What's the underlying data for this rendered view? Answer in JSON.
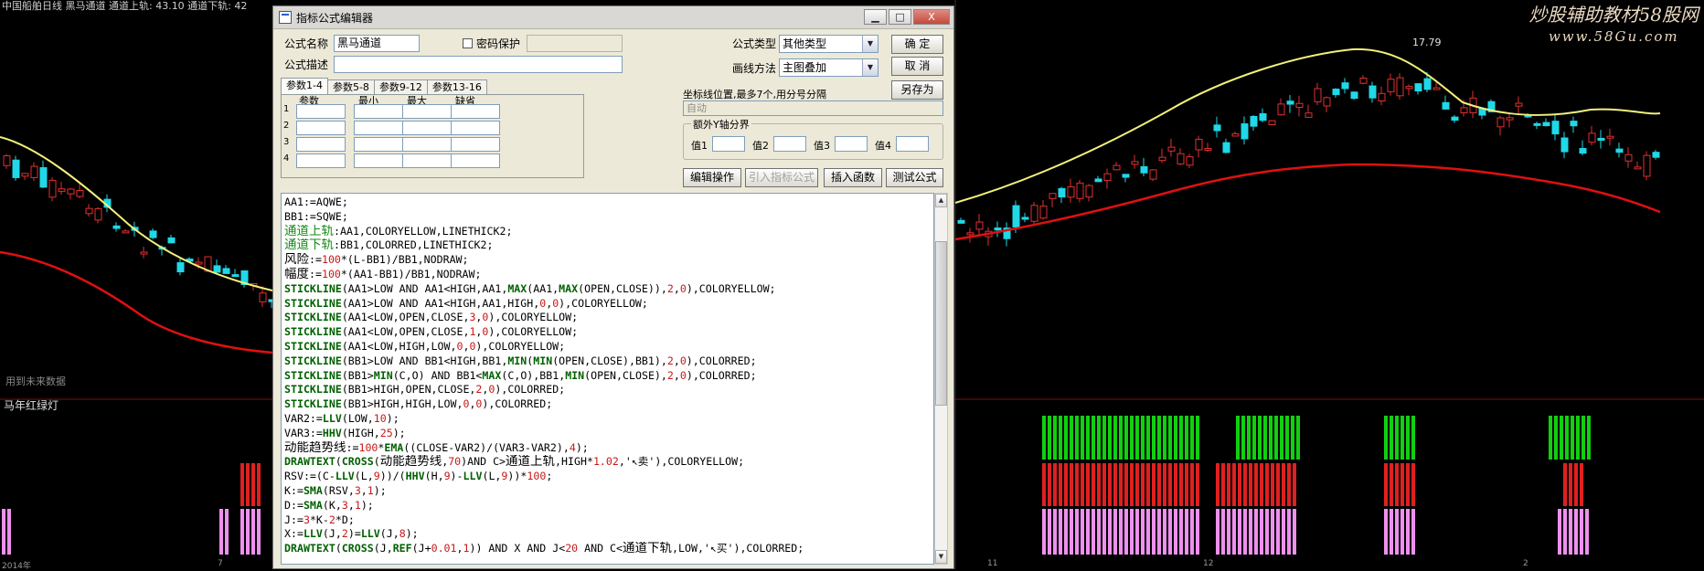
{
  "chart": {
    "top_info": "中国船舶日线  黑马通道  通道上轨: 43.10  通道下轨: 42",
    "peak_label": "17.79",
    "mid_label": "用到未来数据",
    "sub_indicator_label": "马年红绿灯",
    "dates": [
      "2014年",
      "7",
      "11",
      "12",
      "2"
    ],
    "colors": {
      "upper_band": "#f2f07a",
      "lower_band": "#e01010",
      "up_candle": "#e03030",
      "down_candle": "#20d8e8",
      "green_bar": "#10d010",
      "red_bar": "#e02020",
      "pink_bar": "#ee90ee"
    }
  },
  "watermark": {
    "line1": "炒股辅助教材58股网",
    "line2": "www.58Gu.com"
  },
  "dialog": {
    "title": "指标公式编辑器",
    "win_min": "▁",
    "win_max": "□",
    "win_close": "X",
    "name_label": "公式名称",
    "name_value": "黑马通道",
    "password_label": "密码保护",
    "password_value": "",
    "desc_label": "公式描述",
    "desc_value": "",
    "type_label": "公式类型",
    "type_value": "其他类型",
    "draw_label": "画线方法",
    "draw_value": "主图叠加",
    "ok_button": "确  定",
    "cancel_button": "取  消",
    "saveas_button": "另存为",
    "tabs": [
      "参数1-4",
      "参数5-8",
      "参数9-12",
      "参数13-16"
    ],
    "param_headers": [
      "参数",
      "最小",
      "最大",
      "缺省"
    ],
    "param_rows": [
      "1",
      "2",
      "3",
      "4"
    ],
    "coord_label": "坐标线位置,最多7个,用分号分隔",
    "coord_value": "自动",
    "extra_y_legend": "额外Y轴分界",
    "y_labels": [
      "值1",
      "值2",
      "值3",
      "值4"
    ],
    "edit_button": "编辑操作",
    "import_button": "引入指标公式",
    "insert_func_button": "插入函数",
    "test_button": "测试公式",
    "code": [
      [
        [
          "AA1:=AQWE;",
          "black"
        ]
      ],
      [
        [
          "BB1:=SQWE;",
          "black"
        ]
      ],
      [
        [
          "通道上轨",
          "green big"
        ],
        [
          ":AA1,COLORYELLOW,LINETHICK2;",
          "black"
        ]
      ],
      [
        [
          "通道下轨",
          "green big"
        ],
        [
          ":BB1,COLORRED,LINETHICK2;",
          "black"
        ]
      ],
      [
        [
          "风险",
          "black big"
        ],
        [
          ":=",
          "black"
        ],
        [
          "100",
          "red"
        ],
        [
          "*(L-BB1)/BB1,NODRAW;",
          "black"
        ]
      ],
      [
        [
          "幅度",
          "black big"
        ],
        [
          ":=",
          "black"
        ],
        [
          "100",
          "red"
        ],
        [
          "*(AA1-BB1)/BB1,NODRAW;",
          "black"
        ]
      ],
      [
        [
          "STICKLINE",
          "darkgreen bold"
        ],
        [
          "(AA1>LOW AND AA1<HIGH,AA1,",
          "black"
        ],
        [
          "MAX",
          "darkgreen bold"
        ],
        [
          "(AA1,",
          "black"
        ],
        [
          "MAX",
          "darkgreen bold"
        ],
        [
          "(OPEN,CLOSE)),",
          "black"
        ],
        [
          "2",
          "red"
        ],
        [
          ",",
          "black"
        ],
        [
          "0",
          "red"
        ],
        [
          "),COLORYELLOW;",
          "black"
        ]
      ],
      [
        [
          "STICKLINE",
          "darkgreen bold"
        ],
        [
          "(AA1>LOW AND AA1<HIGH,AA1,HIGH,",
          "black"
        ],
        [
          "0",
          "red"
        ],
        [
          ",",
          "black"
        ],
        [
          "0",
          "red"
        ],
        [
          "),COLORYELLOW;",
          "black"
        ]
      ],
      [
        [
          "STICKLINE",
          "darkgreen bold"
        ],
        [
          "(AA1<LOW,OPEN,CLOSE,",
          "black"
        ],
        [
          "3",
          "red"
        ],
        [
          ",",
          "black"
        ],
        [
          "0",
          "red"
        ],
        [
          "),COLORYELLOW;",
          "black"
        ]
      ],
      [
        [
          "STICKLINE",
          "darkgreen bold"
        ],
        [
          "(AA1<LOW,OPEN,CLOSE,",
          "black"
        ],
        [
          "1",
          "red"
        ],
        [
          ",",
          "black"
        ],
        [
          "0",
          "red"
        ],
        [
          "),COLORYELLOW;",
          "black"
        ]
      ],
      [
        [
          "STICKLINE",
          "darkgreen bold"
        ],
        [
          "(AA1<LOW,HIGH,LOW,",
          "black"
        ],
        [
          "0",
          "red"
        ],
        [
          ",",
          "black"
        ],
        [
          "0",
          "red"
        ],
        [
          "),COLORYELLOW;",
          "black"
        ]
      ],
      [
        [
          "STICKLINE",
          "darkgreen bold"
        ],
        [
          "(BB1>LOW AND BB1<HIGH,BB1,",
          "black"
        ],
        [
          "MIN",
          "darkgreen bold"
        ],
        [
          "(",
          "black"
        ],
        [
          "MIN",
          "darkgreen bold"
        ],
        [
          "(OPEN,CLOSE),BB1),",
          "black"
        ],
        [
          "2",
          "red"
        ],
        [
          ",",
          "black"
        ],
        [
          "0",
          "red"
        ],
        [
          "),COLORRED;",
          "black"
        ]
      ],
      [
        [
          "STICKLINE",
          "darkgreen bold"
        ],
        [
          "(BB1>",
          "black"
        ],
        [
          "MIN",
          "darkgreen bold"
        ],
        [
          "(C,O) AND BB1<",
          "black"
        ],
        [
          "MAX",
          "darkgreen bold"
        ],
        [
          "(C,O),BB1,",
          "black"
        ],
        [
          "MIN",
          "darkgreen bold"
        ],
        [
          "(OPEN,CLOSE),",
          "black"
        ],
        [
          "2",
          "red"
        ],
        [
          ",",
          "black"
        ],
        [
          "0",
          "red"
        ],
        [
          "),COLORRED;",
          "black"
        ]
      ],
      [
        [
          "STICKLINE",
          "darkgreen bold"
        ],
        [
          "(BB1>HIGH,OPEN,CLOSE,",
          "black"
        ],
        [
          "2",
          "red"
        ],
        [
          ",",
          "black"
        ],
        [
          "0",
          "red"
        ],
        [
          "),COLORRED;",
          "black"
        ]
      ],
      [
        [
          "STICKLINE",
          "darkgreen bold"
        ],
        [
          "(BB1>HIGH,HIGH,LOW,",
          "black"
        ],
        [
          "0",
          "red"
        ],
        [
          ",",
          "black"
        ],
        [
          "0",
          "red"
        ],
        [
          "),COLORRED;",
          "black"
        ]
      ],
      [
        [
          "VAR2:=",
          "black"
        ],
        [
          "LLV",
          "darkgreen bold"
        ],
        [
          "(LOW,",
          "black"
        ],
        [
          "10",
          "red"
        ],
        [
          ");",
          "black"
        ]
      ],
      [
        [
          "VAR3:=",
          "black"
        ],
        [
          "HHV",
          "darkgreen bold"
        ],
        [
          "(HIGH,",
          "black"
        ],
        [
          "25",
          "red"
        ],
        [
          ");",
          "black"
        ]
      ],
      [
        [
          "动能趋势线",
          "black big"
        ],
        [
          ":=",
          "black"
        ],
        [
          "100",
          "red"
        ],
        [
          "*",
          "black"
        ],
        [
          "EMA",
          "darkgreen bold"
        ],
        [
          "((CLOSE-VAR2)/(VAR3-VAR2),",
          "black"
        ],
        [
          "4",
          "red"
        ],
        [
          ");",
          "black"
        ]
      ],
      [
        [
          "DRAWTEXT",
          "darkgreen bold"
        ],
        [
          "(",
          "black"
        ],
        [
          "CROSS",
          "darkgreen bold"
        ],
        [
          "(",
          "black"
        ],
        [
          "动能趋势线",
          "black big"
        ],
        [
          ",",
          "black"
        ],
        [
          "70",
          "red"
        ],
        [
          ")AND C>",
          "black"
        ],
        [
          "通道上轨",
          "black big"
        ],
        [
          ",HIGH*",
          "black"
        ],
        [
          "1.02",
          "red"
        ],
        [
          ",'↖卖'),COLORYELLOW;",
          "black"
        ]
      ],
      [
        [
          "RSV:=(C-",
          "black"
        ],
        [
          "LLV",
          "darkgreen bold"
        ],
        [
          "(L,",
          "black"
        ],
        [
          "9",
          "red"
        ],
        [
          "))/(",
          "black"
        ],
        [
          "HHV",
          "darkgreen bold"
        ],
        [
          "(H,",
          "black"
        ],
        [
          "9",
          "red"
        ],
        [
          ")-",
          "black"
        ],
        [
          "LLV",
          "darkgreen bold"
        ],
        [
          "(L,",
          "black"
        ],
        [
          "9",
          "red"
        ],
        [
          "))*",
          "black"
        ],
        [
          "100",
          "red"
        ],
        [
          ";",
          "black"
        ]
      ],
      [
        [
          "K:=",
          "black"
        ],
        [
          "SMA",
          "darkgreen bold"
        ],
        [
          "(RSV,",
          "black"
        ],
        [
          "3",
          "red"
        ],
        [
          ",",
          "black"
        ],
        [
          "1",
          "red"
        ],
        [
          ");",
          "black"
        ]
      ],
      [
        [
          "D:=",
          "black"
        ],
        [
          "SMA",
          "darkgreen bold"
        ],
        [
          "(K,",
          "black"
        ],
        [
          "3",
          "red"
        ],
        [
          ",",
          "black"
        ],
        [
          "1",
          "red"
        ],
        [
          ");",
          "black"
        ]
      ],
      [
        [
          "J:=",
          "black"
        ],
        [
          "3",
          "red"
        ],
        [
          "*K-",
          "black"
        ],
        [
          "2",
          "red"
        ],
        [
          "*D;",
          "black"
        ]
      ],
      [
        [
          "X:=",
          "black"
        ],
        [
          "LLV",
          "darkgreen bold"
        ],
        [
          "(J,",
          "black"
        ],
        [
          "2",
          "red"
        ],
        [
          ")=",
          "black"
        ],
        [
          "LLV",
          "darkgreen bold"
        ],
        [
          "(J,",
          "black"
        ],
        [
          "8",
          "red"
        ],
        [
          ");",
          "black"
        ]
      ],
      [
        [
          "DRAWTEXT",
          "darkgreen bold"
        ],
        [
          "(",
          "black"
        ],
        [
          "CROSS",
          "darkgreen bold"
        ],
        [
          "(J,",
          "black"
        ],
        [
          "REF",
          "darkgreen bold"
        ],
        [
          "(J+",
          "black"
        ],
        [
          "0.01",
          "red"
        ],
        [
          ",",
          "black"
        ],
        [
          "1",
          "red"
        ],
        [
          ")) AND X AND J<",
          "black"
        ],
        [
          "20",
          "red"
        ],
        [
          " AND C<",
          "black"
        ],
        [
          "通道下轨",
          "black big"
        ],
        [
          ",LOW,'↖买'),COLORRED;",
          "black"
        ]
      ]
    ]
  }
}
